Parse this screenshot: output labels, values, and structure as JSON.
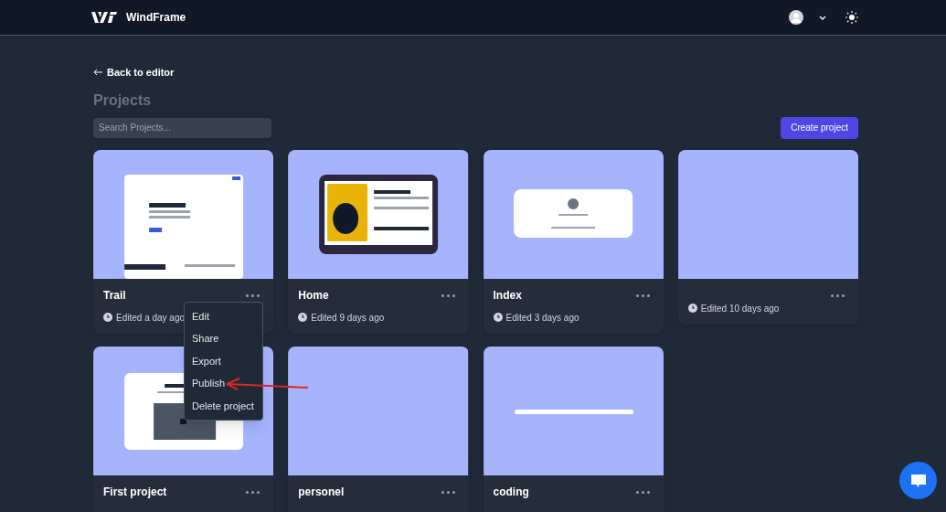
{
  "header": {
    "brand": "WindFrame"
  },
  "back_link": "Back to editor",
  "title": "Projects",
  "search": {
    "placeholder": "Search Projects..."
  },
  "create_button": "Create project",
  "projects": [
    {
      "name": "Trail",
      "edited": "Edited a day ago",
      "kind": "landing",
      "menu_open": true
    },
    {
      "name": "Home",
      "edited": "Edited 9 days ago",
      "kind": "signup",
      "menu_open": false
    },
    {
      "name": "Index",
      "edited": "Edited 3 days ago",
      "kind": "profile",
      "menu_open": false
    },
    {
      "edited": "Edited 10 days ago",
      "kind": "blank",
      "menu_open": false
    },
    {
      "name": "First project",
      "kind": "video",
      "menu_open": false
    },
    {
      "name": "personel",
      "kind": "blank",
      "menu_open": false
    },
    {
      "name": "coding",
      "kind": "searchbar",
      "menu_open": false
    }
  ],
  "menu_items": [
    "Edit",
    "Share",
    "Export",
    "Publish",
    "Delete project"
  ]
}
